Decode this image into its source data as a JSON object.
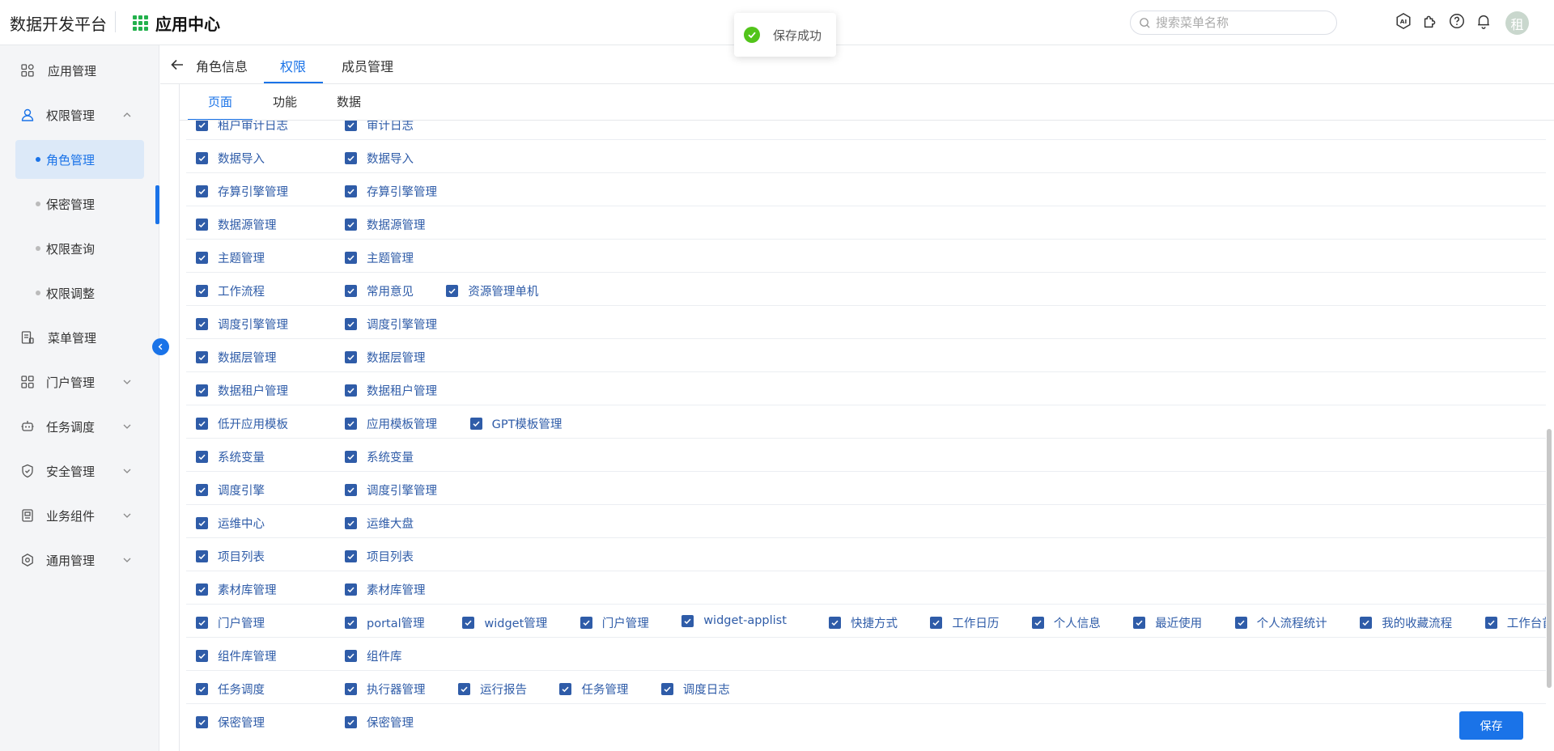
{
  "header": {
    "platform_title": "数据开发平台",
    "app_center_label": "应用中心",
    "search_placeholder": "搜索菜单名称",
    "avatar_text": "租",
    "icons": [
      "ai-icon",
      "plugin-icon",
      "help-icon",
      "bell-icon"
    ]
  },
  "toast": {
    "message": "保存成功"
  },
  "sidebar": {
    "items": [
      {
        "label": "应用管理",
        "icon": "grid-icon",
        "expandable": false
      },
      {
        "label": "权限管理",
        "icon": "user-icon",
        "expandable": true,
        "expanded": true
      },
      {
        "label": "菜单管理",
        "icon": "menu-doc-icon",
        "expandable": false
      },
      {
        "label": "门户管理",
        "icon": "grid-icon",
        "expandable": true
      },
      {
        "label": "任务调度",
        "icon": "robot-icon",
        "expandable": true
      },
      {
        "label": "安全管理",
        "icon": "shield-icon",
        "expandable": true
      },
      {
        "label": "业务组件",
        "icon": "component-icon",
        "expandable": true
      },
      {
        "label": "通用管理",
        "icon": "settings-icon",
        "expandable": true
      }
    ],
    "sub_items": [
      {
        "label": "角色管理",
        "active": true
      },
      {
        "label": "保密管理",
        "active": false
      },
      {
        "label": "权限查询",
        "active": false
      },
      {
        "label": "权限调整",
        "active": false
      }
    ]
  },
  "tabs": {
    "top": [
      "角色信息",
      "权限",
      "成员管理"
    ],
    "top_active": "权限",
    "sub": [
      "页面",
      "功能",
      "数据"
    ],
    "sub_active": "页面"
  },
  "permissions": [
    {
      "module": "租户审计日志",
      "pages": [
        "审计日志"
      ]
    },
    {
      "module": "数据导入",
      "pages": [
        "数据导入"
      ]
    },
    {
      "module": "存算引擎管理",
      "pages": [
        "存算引擎管理"
      ]
    },
    {
      "module": "数据源管理",
      "pages": [
        "数据源管理"
      ]
    },
    {
      "module": "主题管理",
      "pages": [
        "主题管理"
      ]
    },
    {
      "module": "工作流程",
      "pages": [
        "常用意见",
        "资源管理单机"
      ]
    },
    {
      "module": "调度引擎管理",
      "pages": [
        "调度引擎管理"
      ]
    },
    {
      "module": "数据层管理",
      "pages": [
        "数据层管理"
      ]
    },
    {
      "module": "数据租户管理",
      "pages": [
        "数据租户管理"
      ]
    },
    {
      "module": "低开应用模板",
      "pages": [
        "应用模板管理",
        "GPT模板管理"
      ]
    },
    {
      "module": "系统变量",
      "pages": [
        "系统变量"
      ]
    },
    {
      "module": "调度引擎",
      "pages": [
        "调度引擎管理"
      ]
    },
    {
      "module": "运维中心",
      "pages": [
        "运维大盘"
      ]
    },
    {
      "module": "项目列表",
      "pages": [
        "项目列表"
      ]
    },
    {
      "module": "素材库管理",
      "pages": [
        "素材库管理"
      ]
    },
    {
      "module": "门户管理",
      "pages": [
        "portal管理",
        "widget管理",
        "门户管理",
        "widget-applist",
        "快捷方式",
        "工作日历",
        "个人信息",
        "最近使用",
        "个人流程统计",
        "我的收藏流程",
        "工作台首页"
      ]
    },
    {
      "module": "组件库管理",
      "pages": [
        "组件库"
      ]
    },
    {
      "module": "任务调度",
      "pages": [
        "执行器管理",
        "运行报告",
        "任务管理",
        "调度日志"
      ]
    },
    {
      "module": "保密管理",
      "pages": [
        "保密管理"
      ]
    }
  ],
  "save_label": "保存",
  "colors": {
    "accent": "#1a73e8",
    "checkbox": "#2f5ca8",
    "success": "#52c41a"
  }
}
